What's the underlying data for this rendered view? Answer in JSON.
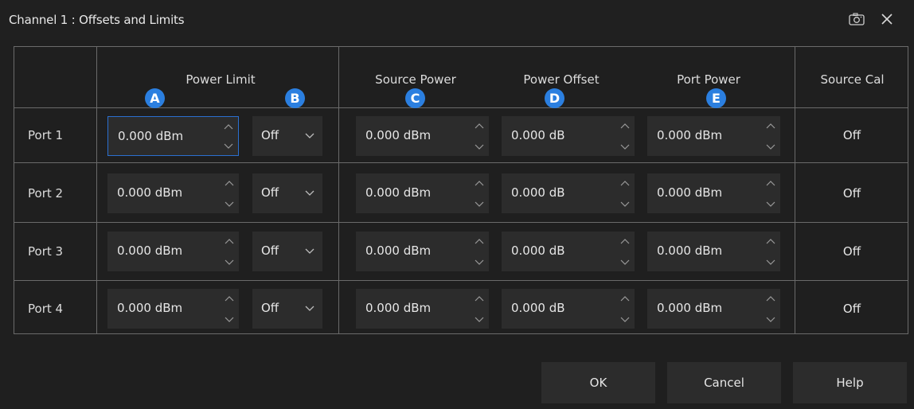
{
  "window": {
    "title": "Channel 1 : Offsets and Limits"
  },
  "icons": {
    "snapshot": "camera-icon",
    "close": "close-icon"
  },
  "columns": {
    "power_limit": "Power Limit",
    "source_power": "Source Power",
    "power_offset": "Power Offset",
    "port_power": "Port Power",
    "source_cal": "Source Cal"
  },
  "callouts": {
    "a": "A",
    "b": "B",
    "c": "C",
    "d": "D",
    "e": "E"
  },
  "rows": [
    {
      "port": "Port 1",
      "power_limit": "0.000 dBm",
      "limit_state": "Off",
      "source_power": "0.000 dBm",
      "power_offset": "0.000 dB",
      "port_power": "0.000 dBm",
      "source_cal": "Off"
    },
    {
      "port": "Port 2",
      "power_limit": "0.000 dBm",
      "limit_state": "Off",
      "source_power": "0.000 dBm",
      "power_offset": "0.000 dB",
      "port_power": "0.000 dBm",
      "source_cal": "Off"
    },
    {
      "port": "Port 3",
      "power_limit": "0.000 dBm",
      "limit_state": "Off",
      "source_power": "0.000 dBm",
      "power_offset": "0.000 dB",
      "port_power": "0.000 dBm",
      "source_cal": "Off"
    },
    {
      "port": "Port 4",
      "power_limit": "0.000 dBm",
      "limit_state": "Off",
      "source_power": "0.000 dBm",
      "power_offset": "0.000 dB",
      "port_power": "0.000 dBm",
      "source_cal": "Off"
    }
  ],
  "buttons": {
    "ok": "OK",
    "cancel": "Cancel",
    "help": "Help"
  },
  "colors": {
    "background": "#1f1f1f",
    "field": "#2c2c2c",
    "grid_line": "#6a6a6a",
    "focus": "#2b6fd0",
    "callout": "#2b7fe0"
  }
}
